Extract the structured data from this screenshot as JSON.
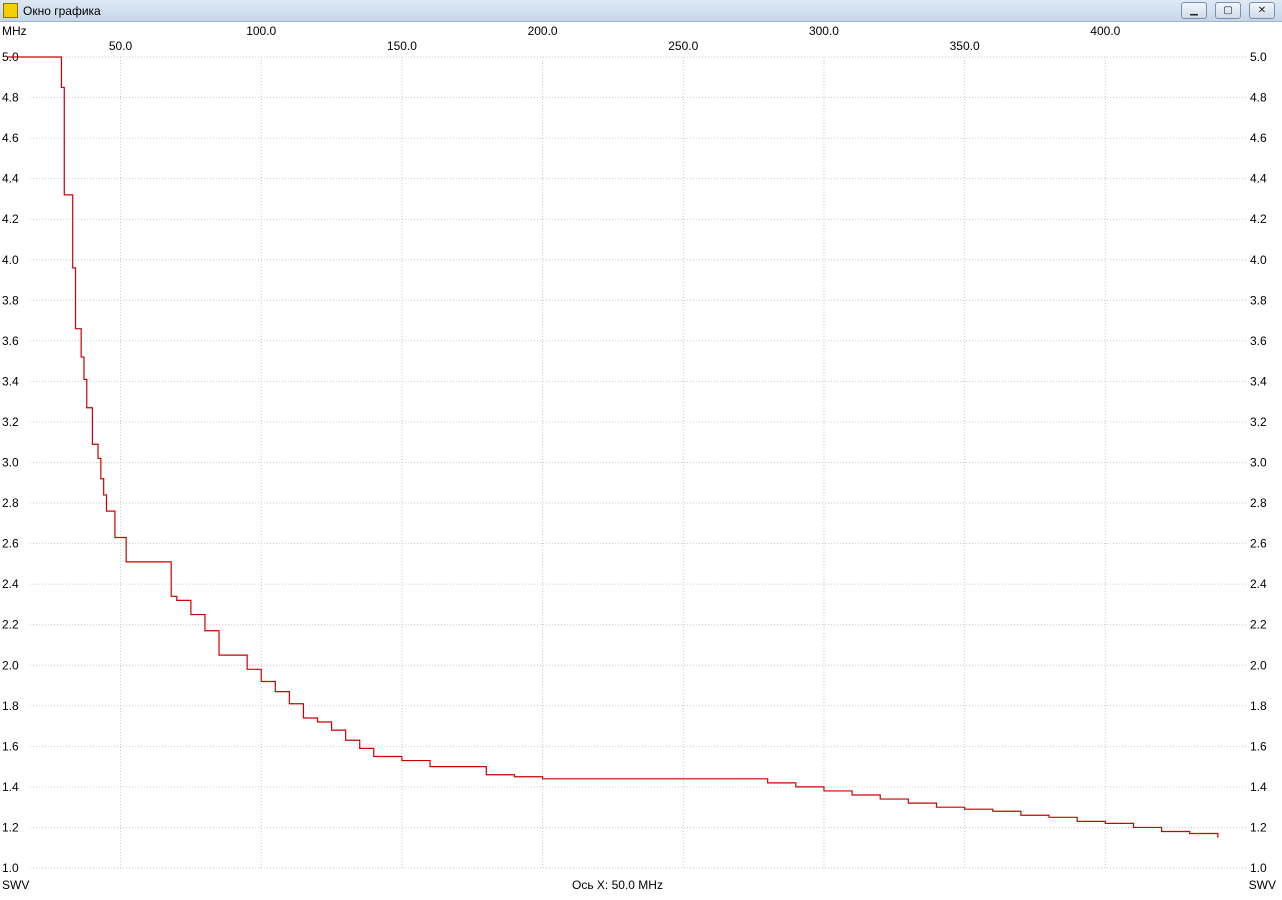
{
  "window": {
    "title": "Окно графика",
    "icon": "chart-window-icon",
    "controls": [
      "minimize-icon",
      "maximize-icon",
      "close-icon"
    ]
  },
  "chart_data": {
    "type": "line",
    "x_unit_label": "MHz",
    "left_axis_label": "SWV",
    "right_axis_label": "SWV",
    "footer_text": "Ось X: 50.0 MHz",
    "xlim": [
      10,
      450
    ],
    "ylim": [
      1.0,
      5.0
    ],
    "x_ticks_upper": [
      "100.0",
      "200.0",
      "300.0",
      "400.0"
    ],
    "x_ticks_lower": [
      "50.0",
      "150.0",
      "250.0",
      "350.0"
    ],
    "y_ticks": [
      "5.0",
      "4.8",
      "4.6",
      "4.4",
      "4.2",
      "4.0",
      "3.8",
      "3.6",
      "3.4",
      "3.2",
      "3.0",
      "2.8",
      "2.6",
      "2.4",
      "2.2",
      "2.0",
      "1.8",
      "1.6",
      "1.4",
      "1.2",
      "1.0"
    ],
    "grid": true,
    "line_color": "#cc0000",
    "series": [
      {
        "x": [
          10,
          28,
          29,
          30,
          32,
          33,
          34,
          35,
          36,
          37,
          38,
          40,
          42,
          43,
          44,
          45,
          46,
          48,
          50,
          52,
          55,
          58,
          62,
          68,
          70,
          75,
          80,
          85,
          90,
          95,
          100,
          105,
          110,
          115,
          120,
          125,
          130,
          135,
          140,
          150,
          160,
          170,
          180,
          190,
          200,
          220,
          240,
          260,
          275,
          280,
          290,
          300,
          310,
          320,
          330,
          340,
          350,
          360,
          370,
          380,
          390,
          400,
          410,
          420,
          430,
          440
        ],
        "y": [
          5.0,
          5.0,
          4.85,
          4.32,
          4.32,
          3.96,
          3.66,
          3.66,
          3.52,
          3.41,
          3.27,
          3.09,
          3.02,
          2.92,
          2.84,
          2.76,
          2.76,
          2.63,
          2.63,
          2.51,
          2.51,
          2.51,
          2.51,
          2.34,
          2.32,
          2.25,
          2.17,
          2.05,
          2.05,
          1.98,
          1.92,
          1.87,
          1.81,
          1.74,
          1.72,
          1.68,
          1.63,
          1.59,
          1.55,
          1.53,
          1.5,
          1.5,
          1.46,
          1.45,
          1.44,
          1.44,
          1.44,
          1.44,
          1.44,
          1.42,
          1.4,
          1.38,
          1.36,
          1.34,
          1.32,
          1.3,
          1.29,
          1.28,
          1.26,
          1.25,
          1.23,
          1.22,
          1.2,
          1.18,
          1.17,
          1.15
        ]
      }
    ]
  }
}
